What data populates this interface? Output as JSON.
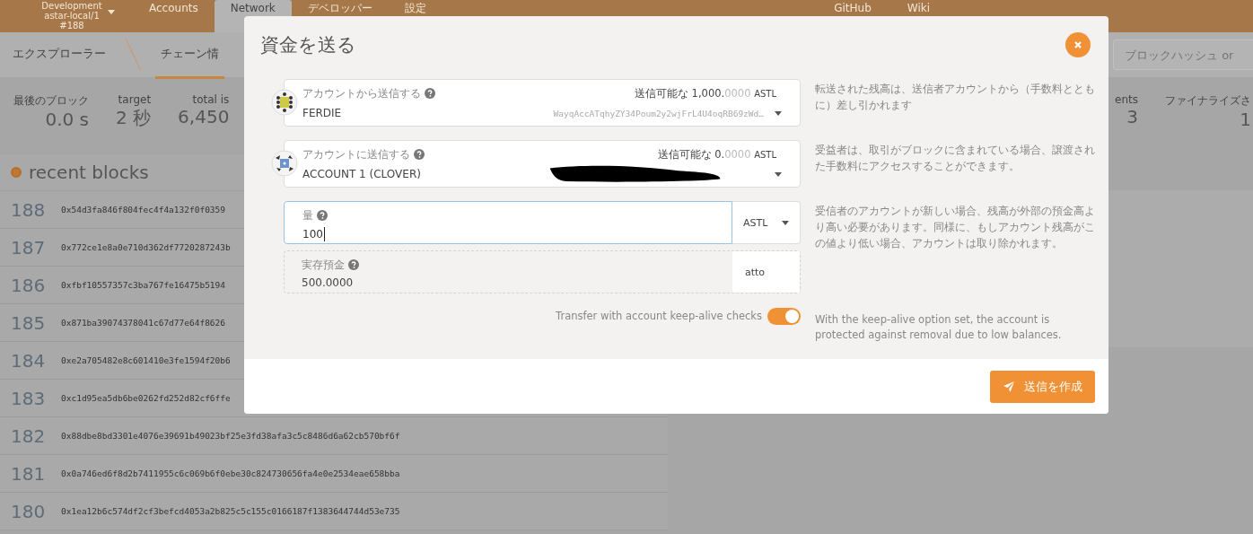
{
  "header": {
    "network": {
      "name": "Development",
      "chain": "astar-local/1",
      "block": "#188"
    },
    "menu": [
      {
        "label": "Accounts",
        "selected": false
      },
      {
        "label": "Network",
        "selected": true
      },
      {
        "label": "デベロッパー",
        "selected": false
      },
      {
        "label": "設定",
        "selected": false
      }
    ],
    "links": [
      "GitHub",
      "Wiki"
    ]
  },
  "subnav": {
    "items": [
      {
        "label": "エクスプローラー",
        "selected": false
      },
      {
        "label": "チェーン情",
        "selected": true
      }
    ],
    "search": {
      "placeholder": "ブロックハッシュ or"
    }
  },
  "stats": [
    {
      "label": "最後のブロック",
      "value": "0.0 s"
    },
    {
      "label": "target",
      "value": "2 秒"
    },
    {
      "label": "total is",
      "value": "6,450"
    }
  ],
  "stats_right": [
    {
      "label": "ents",
      "value": "3"
    },
    {
      "label": "ファイナライズさ",
      "value": "1"
    }
  ],
  "recent_blocks": {
    "title": "recent blocks",
    "rows": [
      {
        "number": "188",
        "hash": "0x54d3fa846f804fec4f4a132f0f0359"
      },
      {
        "number": "187",
        "hash": "0x772ce1e8a0e710d362df7720287243b"
      },
      {
        "number": "186",
        "hash": "0xfbf10557357c3ba767fe16475b5194"
      },
      {
        "number": "185",
        "hash": "0x871ba39074378041c67d77e64f8626"
      },
      {
        "number": "184",
        "hash": "0xe2a705482e8c601410e3fe1594f20b6"
      },
      {
        "number": "183",
        "hash": "0xc1d95ea5db6be0262fd252d82cf6ffe"
      },
      {
        "number": "182",
        "hash": "0x88dbe8bd3301e4076e39691b49023bf25e3fd38afa3c5c8486d6a62cb570bf6f"
      },
      {
        "number": "181",
        "hash": "0x0a746ed6f8d2b7411955c6c069b6f0ebe30c824730656fa4e0e2534eae658bba"
      },
      {
        "number": "180",
        "hash": "0x1ea12b6c574df2cf3befcd4053a2b825c5c155c0166187f1383644744d53e735"
      }
    ]
  },
  "modal": {
    "title": "資金を送る",
    "accounts": [
      {
        "label": "アカウントから送信する",
        "name": "FERDIE",
        "balance_label": "送信可能な",
        "balance_int": "1,000.",
        "balance_dec": "0000",
        "unit": "ASTL",
        "address": "WayqAccATqhyZY34Poum2y2wjFrL4U4oqRB69zWd…",
        "help": "転送された残高は、送信者アカウントから（手数料とともに）差し引かれます"
      },
      {
        "label": "アカウントに送信する",
        "name": "ACCOUNT 1 (CLOVER)",
        "balance_label": "送信可能な",
        "balance_int": "0.",
        "balance_dec": "0000",
        "unit": "ASTL",
        "help": "受益者は、取引がブロックに含まれている場合、譲渡された手数料にアクセスすることができます。"
      }
    ],
    "amount": {
      "label": "量",
      "value": "100",
      "unit": "ASTL",
      "help": "受信者のアカウントが新しい場合、残高が外部の預金高より高い必要があります。同様に、もしアカウント残高がこの値より低い場合、アカウントは取り除かれます。"
    },
    "existential": {
      "label": "実存預金",
      "value": "500.0000",
      "unit": "atto"
    },
    "keep_alive": {
      "label": "Transfer with account keep-alive checks",
      "on": true,
      "help": "With the keep-alive option set, the account is protected against removal due to low balances."
    },
    "submit": "送信を作成"
  }
}
